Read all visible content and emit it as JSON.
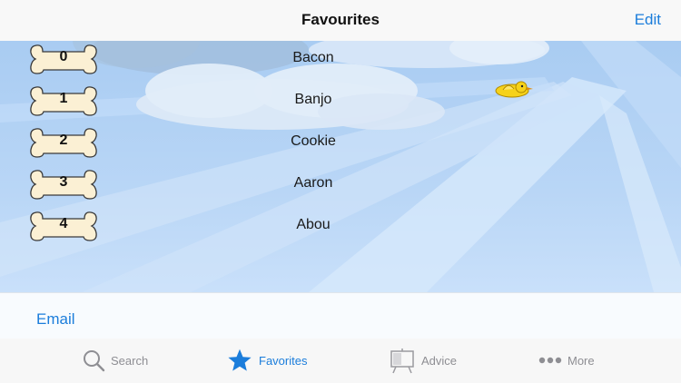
{
  "nav": {
    "title": "Favourites",
    "edit_label": "Edit"
  },
  "list": [
    {
      "number": "0",
      "name": "Bacon"
    },
    {
      "number": "1",
      "name": "Banjo"
    },
    {
      "number": "2",
      "name": "Cookie"
    },
    {
      "number": "3",
      "name": "Aaron"
    },
    {
      "number": "4",
      "name": "Abou"
    }
  ],
  "footer": {
    "email_label": "Email"
  },
  "tabs": [
    {
      "label": "Search",
      "icon": "search-icon",
      "selected": false
    },
    {
      "label": "Favorites",
      "icon": "star-icon",
      "selected": true
    },
    {
      "label": "Advice",
      "icon": "easel-icon",
      "selected": false
    },
    {
      "label": "More",
      "icon": "more-dots-icon",
      "selected": false
    }
  ],
  "colors": {
    "accent": "#1b7ddb",
    "inactive_tab": "#8e8e93",
    "bone": "#fbf0d4",
    "sky": "#a9ccf2"
  }
}
